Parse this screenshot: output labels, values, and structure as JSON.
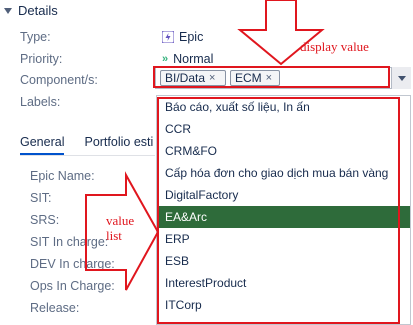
{
  "section": {
    "title": "Details"
  },
  "fields": {
    "type": {
      "label": "Type:",
      "value": "Epic"
    },
    "priority": {
      "label": "Priority:",
      "value": "Normal"
    },
    "components": {
      "label": "Component/s:",
      "tags": [
        "BI/Data",
        "ECM"
      ],
      "remove_glyph": "×"
    },
    "labels": {
      "label": "Labels:"
    }
  },
  "tabs": [
    {
      "label": "General",
      "active": true
    },
    {
      "label": "Portfolio esti"
    }
  ],
  "tab_fields": [
    {
      "label": "Epic Name:"
    },
    {
      "label": "SIT:"
    },
    {
      "label": "SRS:"
    },
    {
      "label": "SIT In charge:"
    },
    {
      "label": "DEV In charge:"
    },
    {
      "label": "Ops In Charge:"
    },
    {
      "label": "Release:"
    }
  ],
  "dropdown": {
    "selected": "EA&Arc",
    "options": [
      "Báo cáo, xuất số liệu, In ấn",
      "CCR",
      "CRM&FO",
      "Cấp hóa đơn cho giao dịch mua bán vàng",
      "DigitalFactory",
      "EA&Arc",
      "ERP",
      "ESB",
      "InterestProduct",
      "ITCorp"
    ]
  },
  "annotations": {
    "display_value": "display value",
    "value_list_line1": "value",
    "value_list_line2": "list"
  },
  "colors": {
    "annotation": "#e0161e",
    "selected_bg": "#2e6b3a",
    "accent": "#0052cc"
  }
}
